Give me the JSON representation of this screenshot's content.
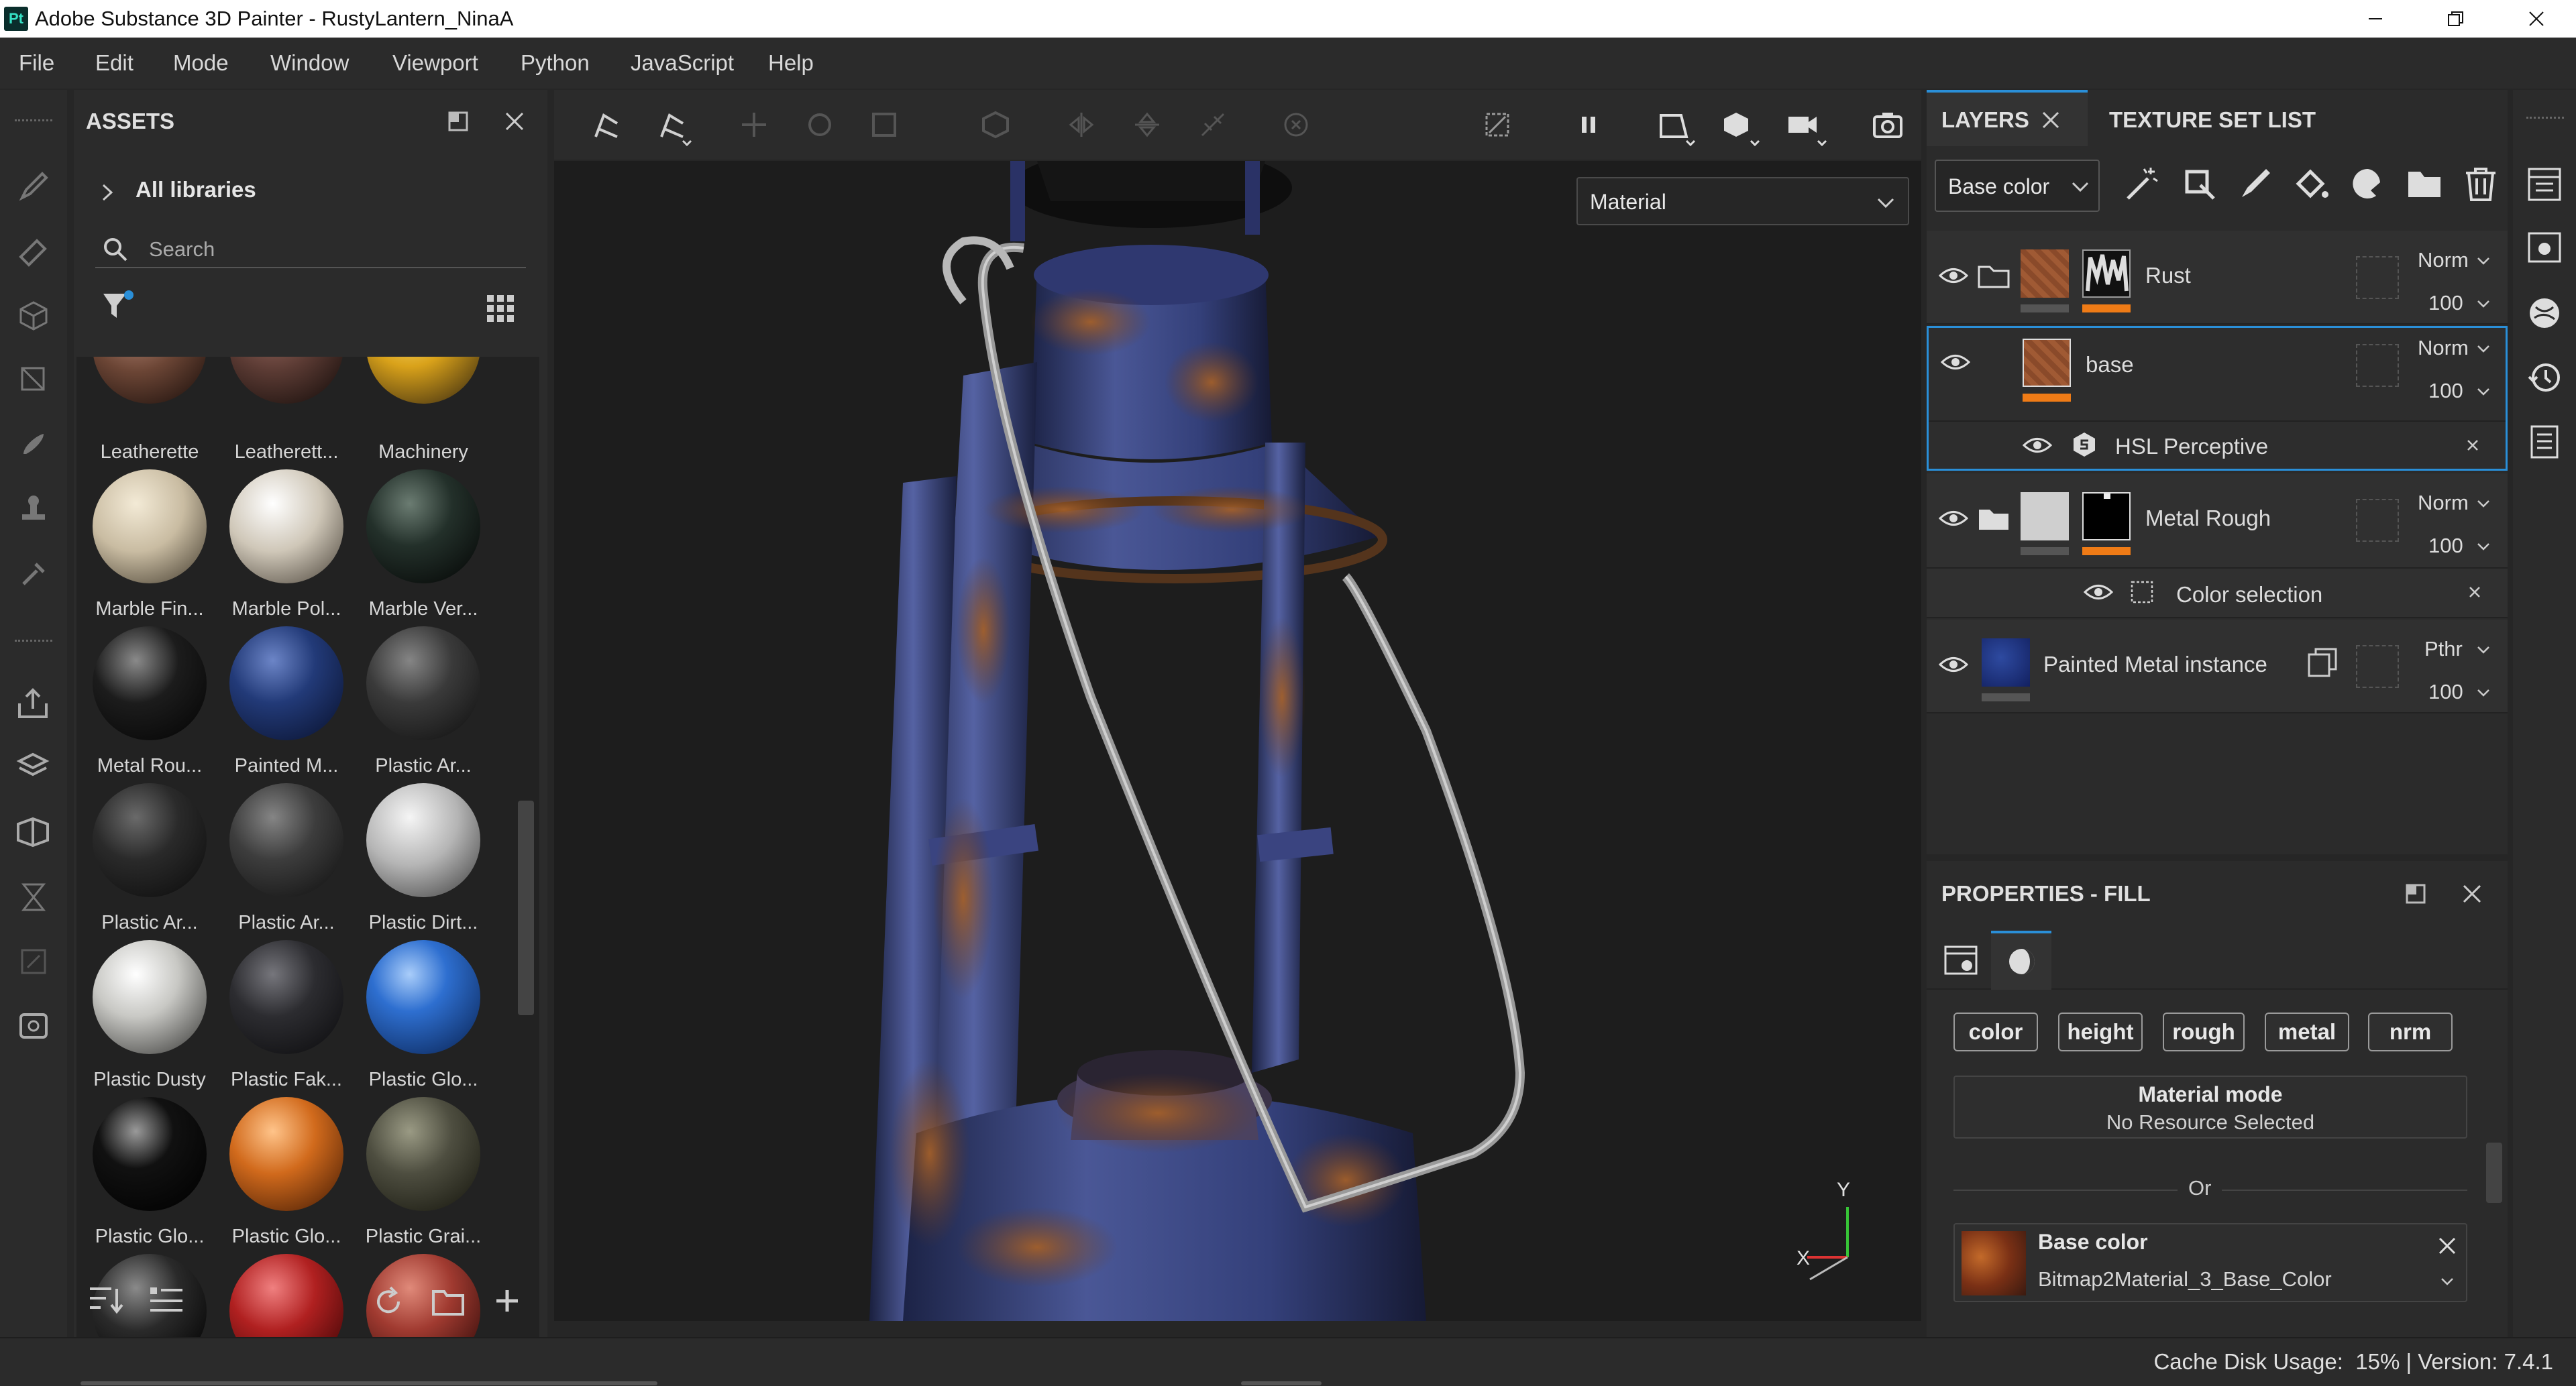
{
  "window": {
    "app_icon": "Pt",
    "title": "Adobe Substance 3D Painter - RustyLantern_NinaA"
  },
  "menu": [
    "File",
    "Edit",
    "Mode",
    "Window",
    "Viewport",
    "Python",
    "JavaScript",
    "Help"
  ],
  "assets": {
    "title": "ASSETS",
    "library": "All libraries",
    "search_placeholder": "Search",
    "items": [
      {
        "label": "Leatherette",
        "color": "#6b4535"
      },
      {
        "label": "Leatherett...",
        "color": "#5a3a33"
      },
      {
        "label": "Machinery",
        "color": "#d9a21a"
      },
      {
        "label": "Marble Fin...",
        "color": "#c9bca2"
      },
      {
        "label": "Marble Pol...",
        "color": "#cfc7b8"
      },
      {
        "label": "Marble Ver...",
        "color": "#23302a"
      },
      {
        "label": "Metal Rou...",
        "color": "#1c1c1c"
      },
      {
        "label": "Painted M...",
        "color": "#223a78"
      },
      {
        "label": "Plastic Ar...",
        "color": "#3a3a3a"
      },
      {
        "label": "Plastic Ar...",
        "color": "#2a2a2a"
      },
      {
        "label": "Plastic Ar...",
        "color": "#3d3d3d"
      },
      {
        "label": "Plastic Dirt...",
        "color": "#b5b5b5"
      },
      {
        "label": "Plastic Dusty",
        "color": "#c8c8c4"
      },
      {
        "label": "Plastic Fak...",
        "color": "#2c2c30"
      },
      {
        "label": "Plastic Glo...",
        "color": "#2e6fd0"
      },
      {
        "label": "Plastic Glo...",
        "color": "#111111"
      },
      {
        "label": "Plastic Glo...",
        "color": "#d16a1c"
      },
      {
        "label": "Plastic Grai...",
        "color": "#4e4e40"
      }
    ]
  },
  "viewport": {
    "material_dropdown": "Material",
    "axis_y": "Y",
    "axis_x": "X"
  },
  "layers": {
    "tab_layers": "LAYERS",
    "tab_texture_set": "TEXTURE SET LIST",
    "channel_dropdown": "Base color",
    "rows": [
      {
        "name": "Rust",
        "blend": "Norm",
        "opacity": "100"
      },
      {
        "name": "base",
        "blend": "Norm",
        "opacity": "100",
        "effect": "HSL Perceptive"
      },
      {
        "name": "Metal Rough",
        "blend": "Norm",
        "opacity": "100",
        "effect": "Color selection"
      },
      {
        "name": "Painted Metal instance",
        "blend": "Pthr",
        "opacity": "100"
      }
    ]
  },
  "properties": {
    "title": "PROPERTIES - FILL",
    "channels": [
      "color",
      "height",
      "rough",
      "metal",
      "nrm"
    ],
    "material_mode_title": "Material mode",
    "material_mode_value": "No Resource Selected",
    "or_label": "Or",
    "base_color_title": "Base color",
    "base_color_resource": "Bitmap2Material_3_Base_Color"
  },
  "status": {
    "text": "Cache Disk Usage:  15% | Version: 7.4.1"
  },
  "colors": {
    "accent": "#2a8fd8",
    "orange": "#ef7b16",
    "panel": "#2b2b2b"
  }
}
